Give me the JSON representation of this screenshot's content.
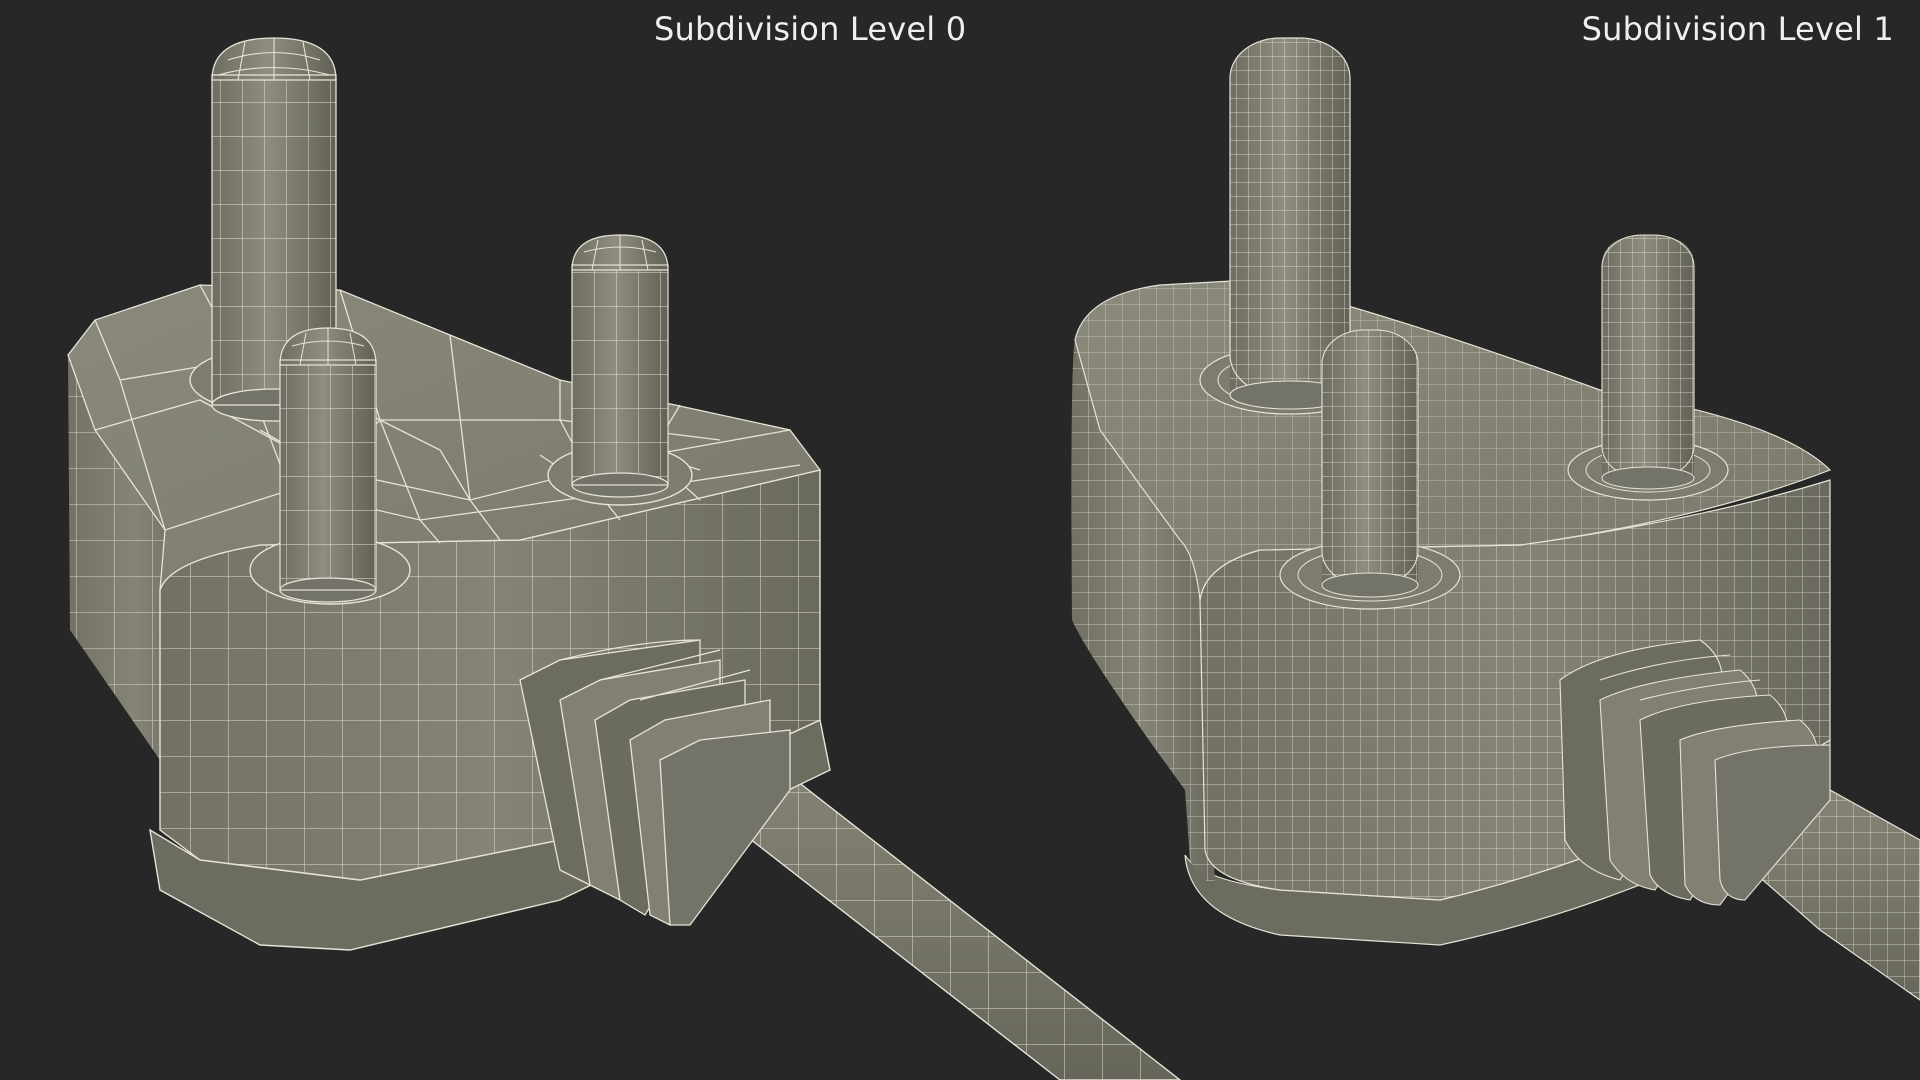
{
  "labels": {
    "left": "Subdivision Level 0",
    "right": "Subdivision Level 1"
  },
  "colors": {
    "background": "#272727",
    "mesh_fill": "#7c7b6e",
    "mesh_dark": "#5f5e55",
    "wire": "#e6e4d6",
    "label_text": "#efefef"
  }
}
